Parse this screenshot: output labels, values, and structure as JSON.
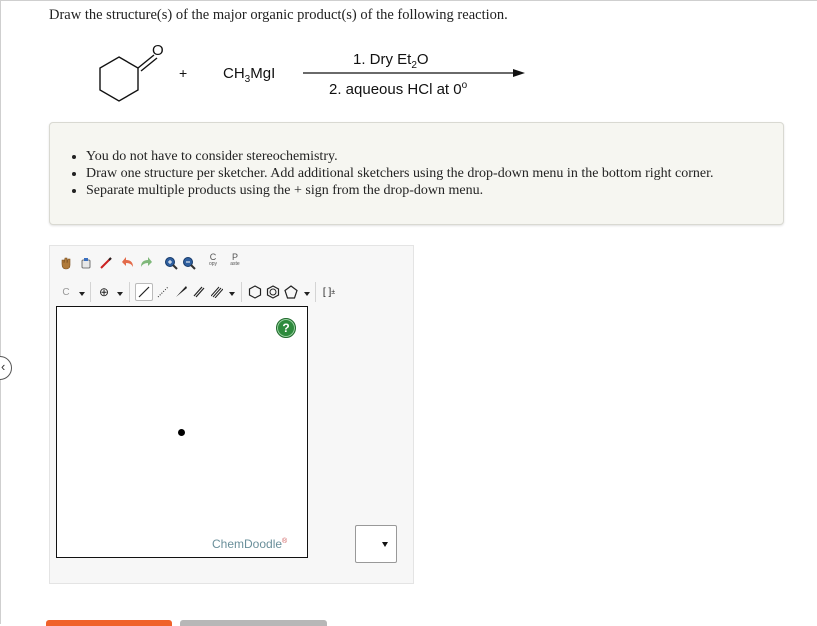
{
  "question": {
    "prompt": "Draw the structure(s) of the major organic product(s) of the following reaction."
  },
  "reaction": {
    "plus_sign": "+",
    "reagent": {
      "prefix": "CH",
      "sub": "3",
      "suffix": "MgI"
    },
    "ketone_oxygen": "O",
    "condition_1": {
      "prefix": "1. Dry Et",
      "sub": "2",
      "suffix": "O"
    },
    "condition_2": {
      "prefix": "2. aqueous HCl at 0",
      "sup": "o"
    }
  },
  "instructions": {
    "items": [
      "You do not have to consider stereochemistry.",
      "Draw one structure per sketcher. Add additional sketchers using the drop-down menu in the bottom right corner.",
      "Separate multiple products using the + sign from the drop-down menu."
    ]
  },
  "sketcher": {
    "toolbar": {
      "copy_label_top": "C",
      "copy_label_bottom": "opy",
      "paste_label_top": "P",
      "paste_label_bottom": "aste",
      "element_label": "C",
      "charge_label": "⊕",
      "template_label": "[ ]",
      "template_sup": "±"
    },
    "help_label": "?",
    "watermark": "ChemDoodle",
    "watermark_mark": "®"
  },
  "colors": {
    "help_green": "#2e8b3d",
    "watermark_blue": "#6a8f9a",
    "bottom_button_orange": "#f0622a",
    "bottom_button_gray": "#b7b7b7"
  }
}
